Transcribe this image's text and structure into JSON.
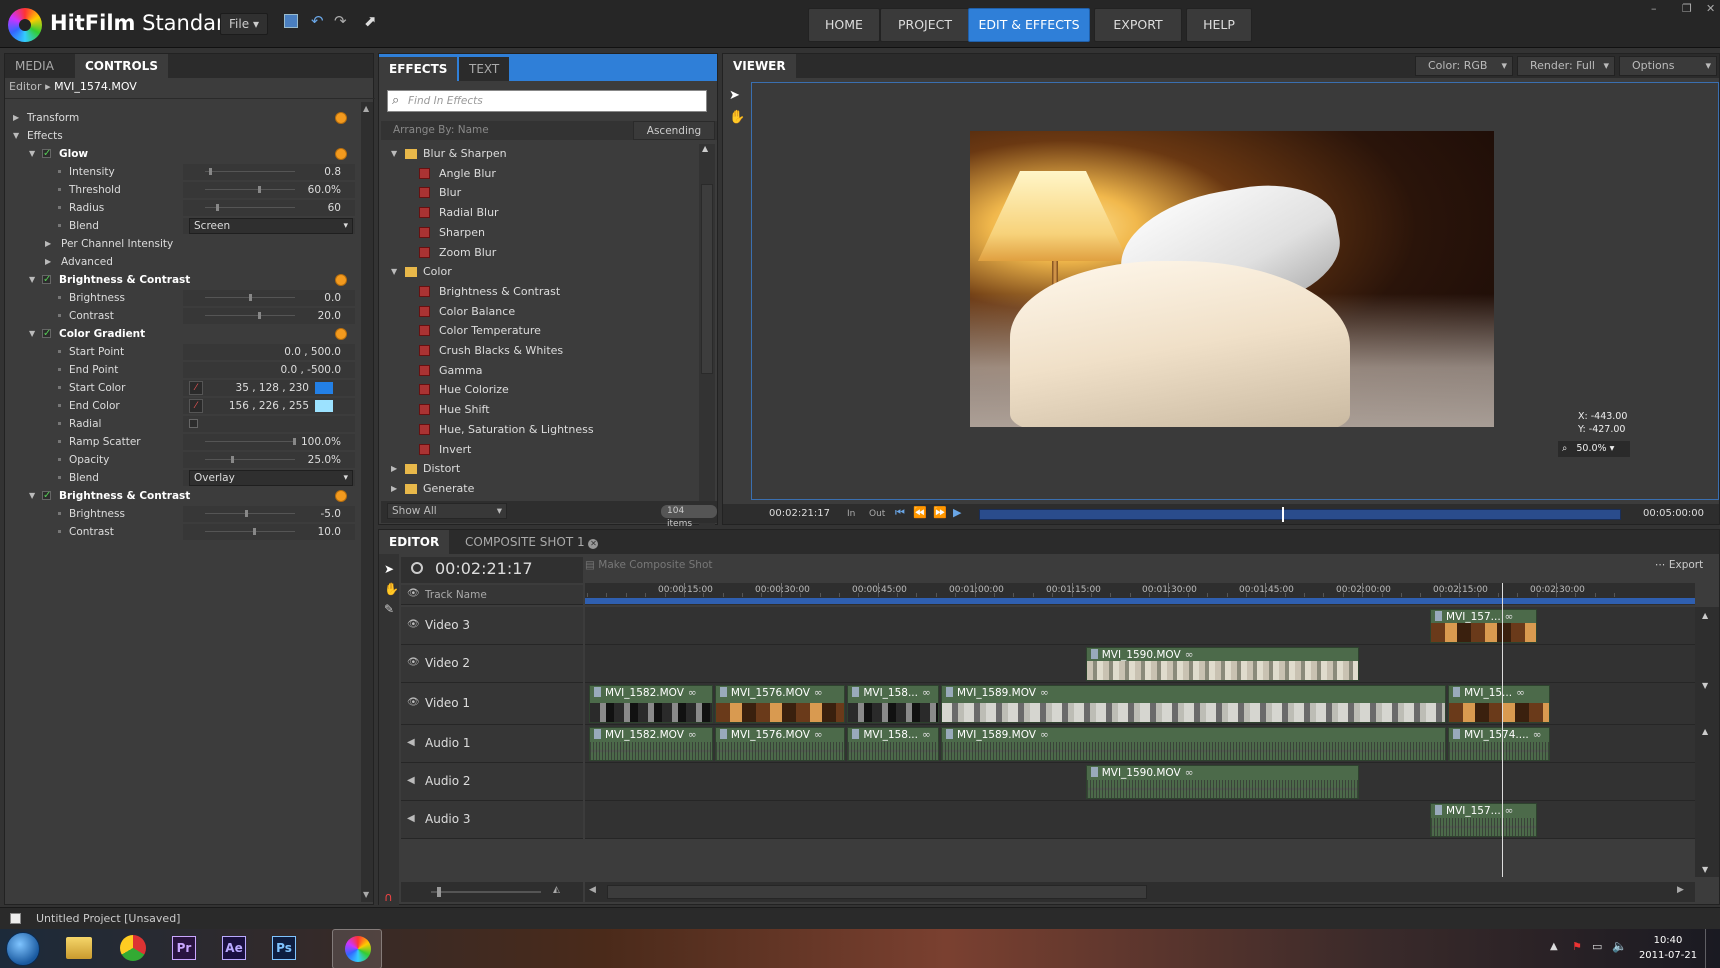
{
  "app": {
    "name_bold": "HitFilm",
    "name_rest": " Standard",
    "file_menu": "File"
  },
  "nav": [
    "HOME",
    "PROJECT",
    "EDIT & EFFECTS",
    "EXPORT",
    "HELP"
  ],
  "left": {
    "tabs": [
      "MEDIA",
      "CONTROLS"
    ],
    "breadcrumb": {
      "root": "Editor",
      "item": "MVI_1574.MOV"
    },
    "rows": [
      {
        "t": "group",
        "label": "Transform",
        "indent": 0,
        "collapsed": true,
        "orange": true
      },
      {
        "t": "group",
        "label": "Effects",
        "indent": 0
      },
      {
        "t": "effect",
        "label": "Glow",
        "orange": true
      },
      {
        "t": "slider",
        "label": "Intensity",
        "value": "0.8",
        "pos": 0.05
      },
      {
        "t": "slider",
        "label": "Threshold",
        "value": "60.0%",
        "pos": 0.6
      },
      {
        "t": "slider",
        "label": "Radius",
        "value": "60",
        "pos": 0.12
      },
      {
        "t": "drop",
        "label": "Blend",
        "value": "Screen"
      },
      {
        "t": "sub",
        "label": "Per Channel Intensity"
      },
      {
        "t": "sub",
        "label": "Advanced"
      },
      {
        "t": "effect",
        "label": "Brightness & Contrast",
        "orange": true
      },
      {
        "t": "slider",
        "label": "Brightness",
        "value": "0.0",
        "pos": 0.5
      },
      {
        "t": "slider",
        "label": "Contrast",
        "value": "20.0",
        "pos": 0.6
      },
      {
        "t": "effect",
        "label": "Color Gradient",
        "orange": true
      },
      {
        "t": "text",
        "label": "Start Point",
        "value": "0.0 ,  500.0"
      },
      {
        "t": "text",
        "label": "End Point",
        "value": "0.0 ,  -500.0"
      },
      {
        "t": "color",
        "label": "Start Color",
        "value": "35 ,  128 ,  230",
        "color": "#2380e6"
      },
      {
        "t": "color",
        "label": "End Color",
        "value": "156 ,  226 ,  255",
        "color": "#9ce2ff"
      },
      {
        "t": "check",
        "label": "Radial"
      },
      {
        "t": "slider",
        "label": "Ramp Scatter",
        "value": "100.0%",
        "pos": 1.0
      },
      {
        "t": "slider",
        "label": "Opacity",
        "value": "25.0%",
        "pos": 0.3
      },
      {
        "t": "drop",
        "label": "Blend",
        "value": "Overlay"
      },
      {
        "t": "effect",
        "label": "Brightness & Contrast",
        "orange": true
      },
      {
        "t": "slider",
        "label": "Brightness",
        "value": "-5.0",
        "pos": 0.45
      },
      {
        "t": "slider",
        "label": "Contrast",
        "value": "10.0",
        "pos": 0.55
      }
    ]
  },
  "effects": {
    "tabs": [
      "EFFECTS",
      "TEXT"
    ],
    "search_placeholder": "Find In Effects",
    "arrange": "Arrange By: Name",
    "sort": "Ascending",
    "items": [
      {
        "f": true,
        "open": true,
        "label": "Blur & Sharpen"
      },
      {
        "label": "Angle Blur"
      },
      {
        "label": "Blur"
      },
      {
        "label": "Radial Blur"
      },
      {
        "label": "Sharpen"
      },
      {
        "label": "Zoom Blur"
      },
      {
        "f": true,
        "open": true,
        "label": "Color"
      },
      {
        "label": "Brightness & Contrast"
      },
      {
        "label": "Color Balance"
      },
      {
        "label": "Color Temperature"
      },
      {
        "label": "Crush Blacks & Whites"
      },
      {
        "label": "Gamma"
      },
      {
        "label": "Hue Colorize"
      },
      {
        "label": "Hue Shift"
      },
      {
        "label": "Hue, Saturation & Lightness"
      },
      {
        "label": "Invert"
      },
      {
        "f": true,
        "label": "Distort"
      },
      {
        "f": true,
        "label": "Generate"
      }
    ],
    "show": "Show All",
    "count": "104 items"
  },
  "viewer": {
    "title": "VIEWER",
    "color": "Color: RGB",
    "render": "Render: Full",
    "options": "Options",
    "coord_x": "X:  -443.00",
    "coord_y": "Y:  -427.00",
    "zoom": "50.0%",
    "timecode": "00:02:21:17",
    "in": "In",
    "out": "Out",
    "end": "00:05:00:00",
    "progress": 0.47
  },
  "editor": {
    "tabs": [
      "EDITOR",
      "COMPOSITE SHOT 1"
    ],
    "timecode": "00:02:21:17",
    "make_composite": "Make Composite Shot",
    "export": "Export",
    "track_name": "Track Name",
    "ruler": [
      "00:00:15:00",
      "00:00:30:00",
      "00:00:45:00",
      "00:01:00:00",
      "00:01:15:00",
      "00:01:30:00",
      "00:01:45:00",
      "00:02:00:00",
      "00:02:15:00",
      "00:02:30:00"
    ],
    "tracks": [
      {
        "name": "Video 3",
        "type": "video",
        "clips": [
          {
            "name": "MVI_157...",
            "s": 130.5,
            "e": 147.0,
            "thumb": "warm"
          }
        ]
      },
      {
        "name": "Video 2",
        "type": "video",
        "clips": [
          {
            "name": "MVI_1590.MOV",
            "s": 77.2,
            "e": 119.5,
            "thumb": "pale"
          }
        ]
      },
      {
        "name": "Video 1",
        "type": "video",
        "clips": [
          {
            "name": "MVI_1582.MOV",
            "s": 0.3,
            "e": 19.5,
            "thumb": "dark"
          },
          {
            "name": "MVI_1576.MOV",
            "s": 19.8,
            "e": 40.0,
            "thumb": "warm"
          },
          {
            "name": "MVI_158...",
            "s": 40.3,
            "e": 54.5,
            "thumb": "dark"
          },
          {
            "name": "MVI_1589.MOV",
            "s": 54.8,
            "e": 133.0,
            "thumb": "grey"
          },
          {
            "name": "MVI_15...",
            "s": 133.3,
            "e": 149.0,
            "thumb": "warm"
          }
        ]
      },
      {
        "name": "Audio 1",
        "type": "audio",
        "clips": [
          {
            "name": "MVI_1582.MOV",
            "s": 0.3,
            "e": 19.5
          },
          {
            "name": "MVI_1576.MOV",
            "s": 19.8,
            "e": 40.0
          },
          {
            "name": "MVI_158...",
            "s": 40.3,
            "e": 54.5
          },
          {
            "name": "MVI_1589.MOV",
            "s": 54.8,
            "e": 133.0
          },
          {
            "name": "MVI_1574....",
            "s": 133.3,
            "e": 149.0
          }
        ]
      },
      {
        "name": "Audio 2",
        "type": "audio",
        "clips": [
          {
            "name": "MVI_1590.MOV",
            "s": 77.2,
            "e": 119.5
          }
        ]
      },
      {
        "name": "Audio 3",
        "type": "audio",
        "clips": [
          {
            "name": "MVI_157...",
            "s": 130.5,
            "e": 147.0
          }
        ]
      }
    ],
    "playhead_seconds": 141.7
  },
  "status": "Untitled Project  [Unsaved]",
  "taskbar": {
    "time": "10:40",
    "date": "2011-07-21",
    "apps": [
      "Pr",
      "Ae",
      "Ps"
    ]
  },
  "colors": {
    "accent": "#2f7fd8",
    "clip_green": "#4c6a4a",
    "orange": "#f39a1e"
  }
}
